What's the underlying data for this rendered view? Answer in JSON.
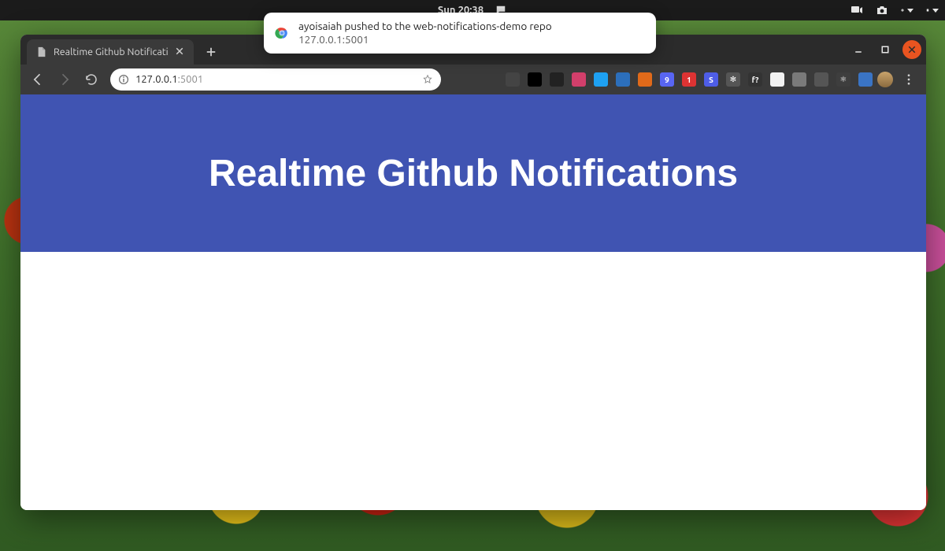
{
  "gnome": {
    "clock": "Sun 20:38"
  },
  "browser": {
    "tab": {
      "title": "Realtime Github Notificati"
    },
    "address": {
      "host": "127.0.0.1",
      "rest": ":5001"
    },
    "extensions": [
      {
        "bg": "#444444",
        "label": ""
      },
      {
        "bg": "#000000",
        "label": ""
      },
      {
        "bg": "#222222",
        "label": ""
      },
      {
        "bg": "#d23f6b",
        "label": ""
      },
      {
        "bg": "#1ea1f2",
        "label": ""
      },
      {
        "bg": "#2c6fbb",
        "label": ""
      },
      {
        "bg": "#e06a1a",
        "label": ""
      },
      {
        "bg": "#5865f2",
        "label": "9"
      },
      {
        "bg": "#d33",
        "label": "1"
      },
      {
        "bg": "#4e5de6",
        "label": "S"
      },
      {
        "bg": "#555555",
        "label": "✻"
      },
      {
        "bg": "#333333",
        "label": "f?"
      },
      {
        "bg": "#f2f2f2",
        "label": ""
      },
      {
        "bg": "#7a7a7a",
        "label": ""
      },
      {
        "bg": "#555555",
        "label": ""
      },
      {
        "bg": "#3e3e3e",
        "label": "⚛"
      },
      {
        "bg": "#3a74c4",
        "label": ""
      }
    ]
  },
  "page": {
    "title": "Realtime Github Notifications"
  },
  "notification": {
    "title": "ayoisaiah pushed to the web-notifications-demo repo",
    "source": "127.0.0.1:5001"
  }
}
